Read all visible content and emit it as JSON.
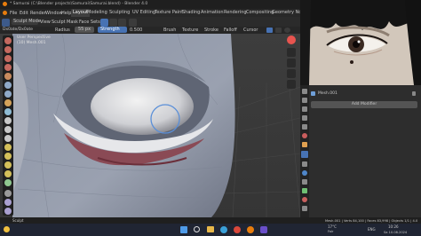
{
  "window": {
    "title": "* Samurai (C:\\Blender projects\\Samurai\\Samurai.blend) - Blender 4.0"
  },
  "menu": {
    "items": [
      "File",
      "Edit",
      "Render",
      "Window",
      "Help"
    ],
    "workspace_tabs": [
      "Layout",
      "Modeling",
      "Sculpting",
      "UV Editing",
      "Texture Paint",
      "Shading",
      "Animation",
      "Rendering",
      "Compositing",
      "Geometry Node"
    ],
    "active_tab": "Layout"
  },
  "toolbar": {
    "mode": "Sculpt Mode",
    "view": "View",
    "sculpt": "Sculpt",
    "mask": "Mask",
    "face_sets": "Face Sets",
    "brush_name": "Radius",
    "brush_value": "55 px",
    "strength_label": "Strength",
    "strength_value": "0.500",
    "brush_menu": "Brush",
    "texture_menu": "Texture",
    "stroke_menu": "Stroke",
    "falloff_menu": "Falloff",
    "cursor_menu": "Cursor"
  },
  "header2": {
    "label": "Dx0ate/Dx0ate"
  },
  "viewport": {
    "overlay_line1": "User Perspective",
    "overlay_line2": "(10) Mesh.001"
  },
  "properties": {
    "object_name": "Mesh.001",
    "add_modifier": "Add Modifier"
  },
  "status": {
    "left": "Sculpt",
    "right": "Mesh.001 | Verts 84,100 | Faces 83,998 | Objects 1/1 | 4.0"
  },
  "taskbar": {
    "temperature": "17°C",
    "weather": "Fair",
    "language": "ENG",
    "time": "10:26",
    "date": "Sa 10.08.2024"
  },
  "colors": {
    "accent_blue": "#4772b3",
    "brush_circle": "#5a8fd8",
    "active_tab": "#3f3f3f"
  }
}
